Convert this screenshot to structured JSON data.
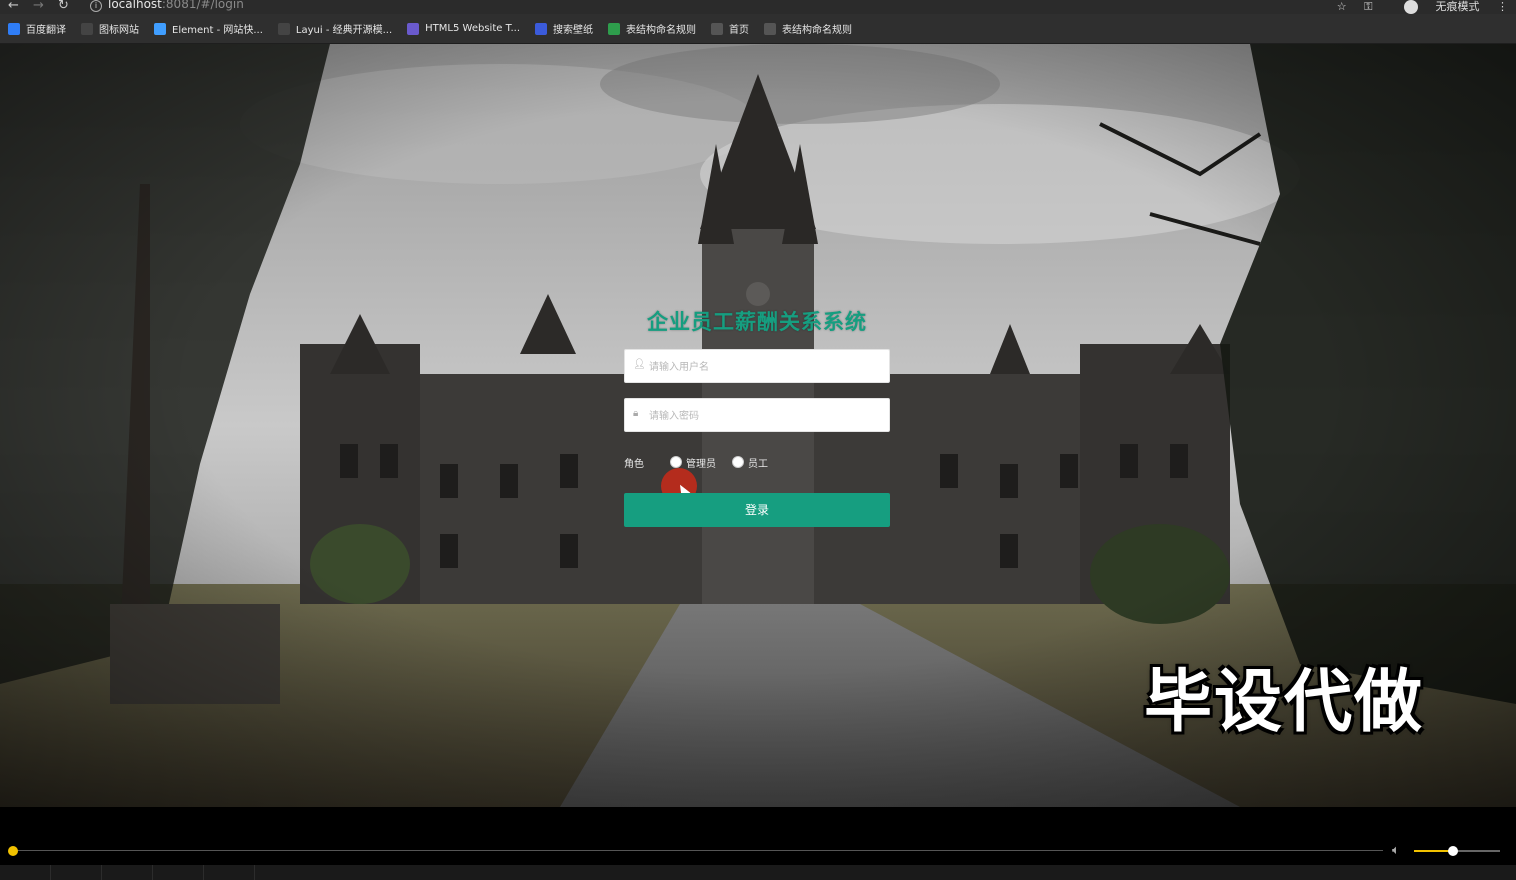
{
  "browser": {
    "url_host": "localhost",
    "url_path": ":8081/#/login",
    "incognito_label": "无痕模式",
    "bookmarks": [
      {
        "label": "百度翻译",
        "icon": "baidu-translate-icon",
        "color": "#2f7df6"
      },
      {
        "label": "图标网站",
        "icon": "flag-icon",
        "color": "#444444"
      },
      {
        "label": "Element - 网站快...",
        "icon": "element-icon",
        "color": "#409eff"
      },
      {
        "label": "Layui - 经典开源模...",
        "icon": "layui-icon",
        "color": "#444444"
      },
      {
        "label": "HTML5 Website T...",
        "icon": "html5-icon",
        "color": "#6a5acd"
      },
      {
        "label": "搜索壁纸",
        "icon": "wallpaper-icon",
        "color": "#3b5bdb"
      },
      {
        "label": "表结构命名规则",
        "icon": "table-icon",
        "color": "#2e9d4c"
      },
      {
        "label": "首页",
        "icon": "globe-icon",
        "color": "#555555"
      },
      {
        "label": "表结构命名规则",
        "icon": "globe-icon",
        "color": "#555555"
      }
    ]
  },
  "login": {
    "title": "企业员工薪酬关系系统",
    "username_placeholder": "请输入用户名",
    "password_placeholder": "请输入密码",
    "role_label": "角色",
    "roles": [
      "管理员",
      "员工"
    ],
    "submit_label": "登录",
    "accent_color": "#169e80"
  },
  "watermark": "毕设代做",
  "player": {
    "progress_fraction": 0.0,
    "volume_fraction": 0.45,
    "accent_color": "#f2c200"
  }
}
